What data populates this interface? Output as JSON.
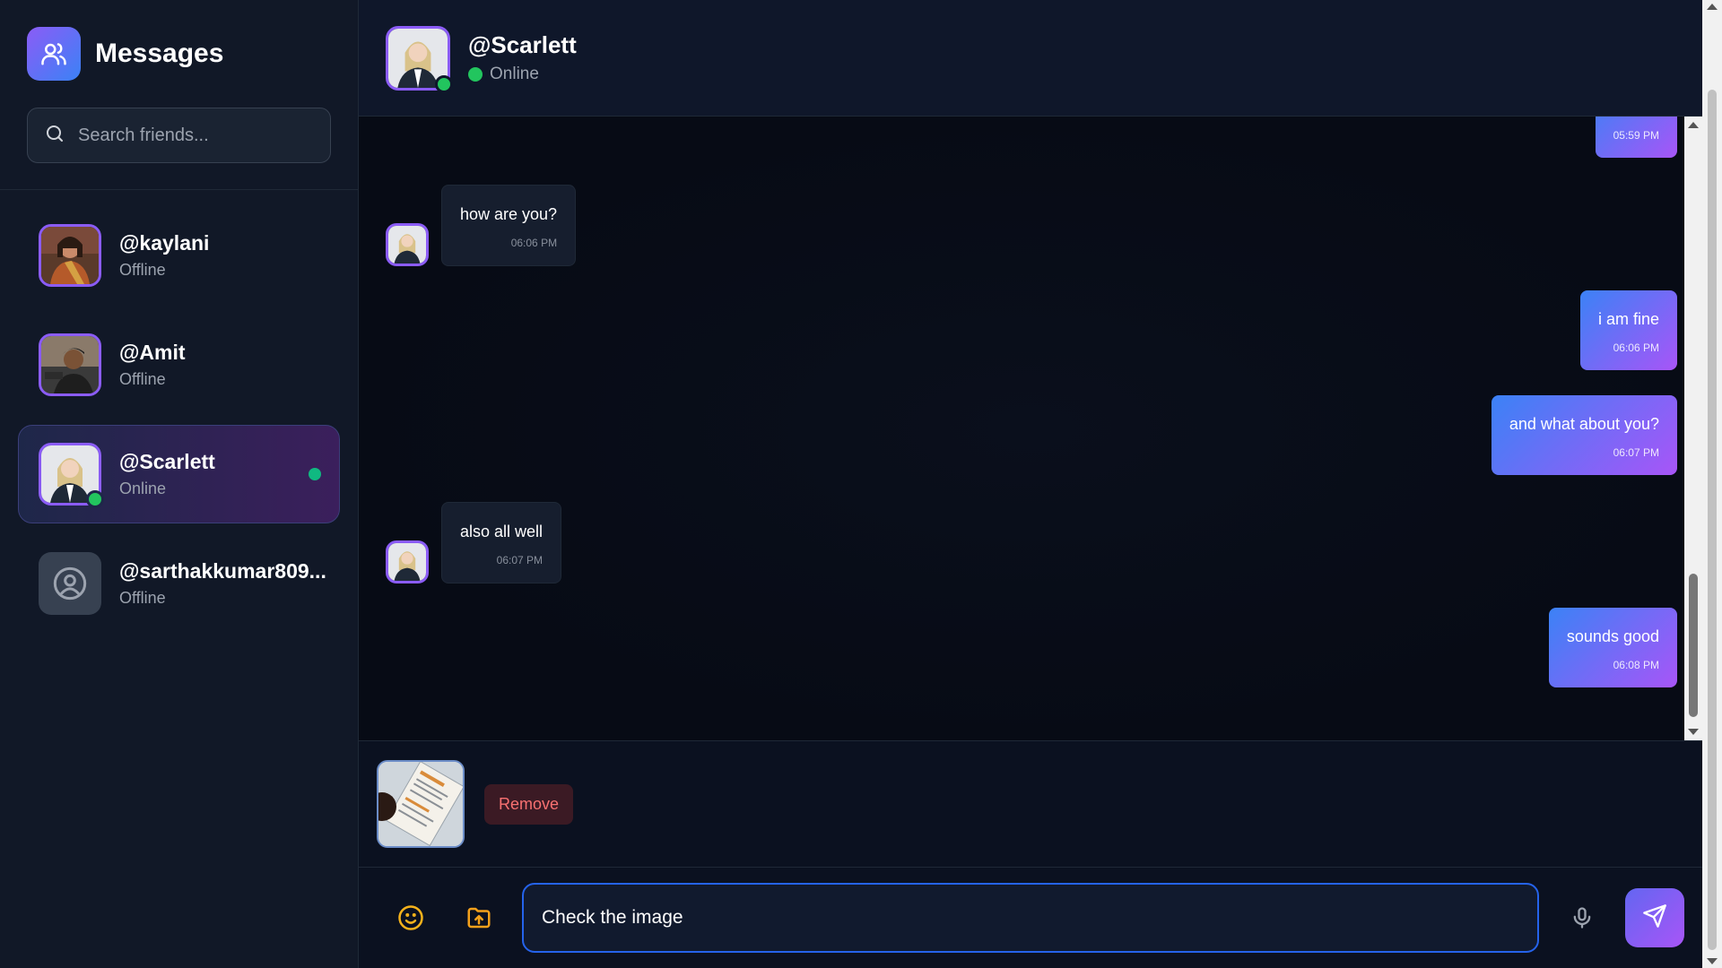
{
  "sidebar": {
    "title": "Messages",
    "search_placeholder": "Search friends...",
    "friends": [
      {
        "name": "@kaylani",
        "status": "Offline"
      },
      {
        "name": "@Amit",
        "status": "Offline"
      },
      {
        "name": "@Scarlett",
        "status": "Online"
      },
      {
        "name": "@sarthakkumar809...",
        "status": "Offline"
      }
    ]
  },
  "chat": {
    "contact_name": "@Scarlett",
    "contact_status": "Online",
    "messages": [
      {
        "direction": "out",
        "text": "",
        "time": "05:59 PM"
      },
      {
        "direction": "in",
        "text": "how are you?",
        "time": "06:06 PM"
      },
      {
        "direction": "out",
        "text": "i am fine",
        "time": "06:06 PM"
      },
      {
        "direction": "out",
        "text": "and what about you?",
        "time": "06:07 PM"
      },
      {
        "direction": "in",
        "text": "also all well",
        "time": "06:07 PM"
      },
      {
        "direction": "out",
        "text": "sounds good",
        "time": "06:08 PM"
      }
    ],
    "attachment": {
      "remove_label": "Remove"
    },
    "composer": {
      "value": "Check the image"
    }
  },
  "colors": {
    "accent_start": "#3b82f6",
    "accent_end": "#a855f7",
    "online": "#22c55e",
    "danger": "#f87171",
    "background": "#0b1120"
  },
  "icons": {
    "brand": "users-icon",
    "search": "search-icon",
    "emoji": "smile-icon",
    "upload": "folder-upload-icon",
    "mic": "microphone-icon",
    "send": "send-icon",
    "default_avatar": "user-circle-icon"
  }
}
